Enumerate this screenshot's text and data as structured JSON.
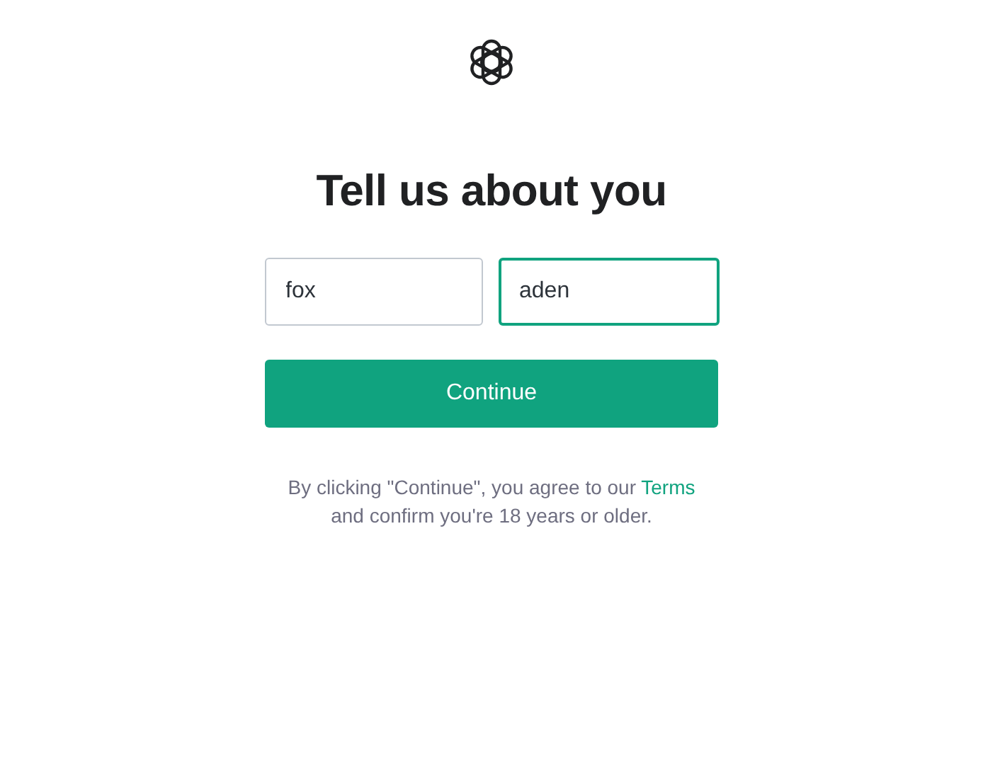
{
  "heading": "Tell us about you",
  "fields": [
    {
      "value": "fox",
      "focused": false
    },
    {
      "value": "aden",
      "focused": true
    }
  ],
  "button": "Continue",
  "notice": {
    "before": "By clicking \"Continue\", you agree to our ",
    "link": "Terms",
    "after": "and confirm you're 18 years or older."
  }
}
